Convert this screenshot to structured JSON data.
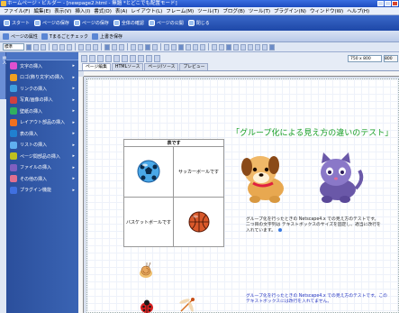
{
  "window": {
    "title": "ホームページ・ビルダー - [newpage2.html - 無題 *とどこでも配置モード]"
  },
  "menu": [
    "ファイル(F)",
    "編集(E)",
    "表示(V)",
    "挿入(I)",
    "書式(O)",
    "表(A)",
    "レイアウト(L)",
    "フレーム(M)",
    "ツール(T)",
    "ブログ(B)",
    "ツール(T)",
    "プラグイン(N)",
    "ウィンドウ(W)",
    "ヘルプ(H)"
  ],
  "toolbar1": [
    "スタート",
    "ページの保存",
    "ページの保存",
    "全体の確認",
    "ページの公開",
    "閉じる"
  ],
  "toolbar2": [
    "ページの属性",
    "Tまるごとチェック",
    "上書き保存"
  ],
  "format_select": "標準",
  "sidebar": {
    "items": [
      {
        "label": "文字の挿入",
        "color": "#e050d0"
      },
      {
        "label": "ロゴ(飾り文字)の挿入",
        "color": "#f0a020"
      },
      {
        "label": "リンクの挿入",
        "color": "#40a0e0"
      },
      {
        "label": "写真/画像の挿入",
        "color": "#d04040"
      },
      {
        "label": "壁紙の挿入",
        "color": "#30b060"
      },
      {
        "label": "レイアウト部品の挿入",
        "color": "#f07020"
      },
      {
        "label": "表の挿入",
        "color": "#2080d0"
      },
      {
        "label": "リストの挿入",
        "color": "#60b0f0"
      },
      {
        "label": "ページ間部品の挿入",
        "color": "#c0c020"
      },
      {
        "label": "ファイルの挿入",
        "color": "#8060c0"
      },
      {
        "label": "その他の挿入",
        "color": "#e07090"
      },
      {
        "label": "プラグイン機能",
        "color": "#4070e0"
      }
    ],
    "vertical_tab": "挿入"
  },
  "doc_tabs": [
    "ページ編集",
    "HTMLソース",
    "ページ/ソース",
    "プレビュー"
  ],
  "zoom": "750 x 800",
  "mode": "800",
  "page": {
    "heading": "「グループ化による見え方の違いのテスト」",
    "table": {
      "caption": "表です",
      "cell_soccer_text": "サッカーボールです",
      "cell_basket_text": "バスケットボールです"
    },
    "para1": "グループ化を行ったときの Netscape4.x での見え方のテストです。二つ目の文字列は テキストボックスのサイズを固定し、適当に改行を入れています。",
    "para2": "グループ化を行ったときの Netscape4.x での見え方のテストです。このテキストボックスには改行を入れてません。"
  }
}
